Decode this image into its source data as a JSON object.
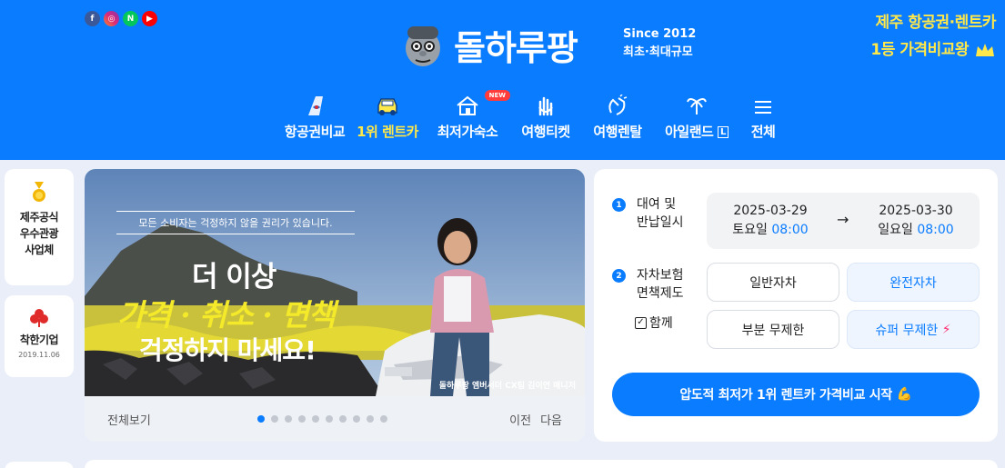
{
  "header": {
    "socials": [
      {
        "name": "facebook-icon",
        "glyph": "f"
      },
      {
        "name": "instagram-icon",
        "glyph": "◎"
      },
      {
        "name": "naver-icon",
        "glyph": "N"
      },
      {
        "name": "youtube-icon",
        "glyph": "▶"
      }
    ],
    "logo_text": "돌하루팡",
    "since_line1": "Since 2012",
    "since_line2": "최초·최대규모",
    "promo_line1": "제주 항공권·렌트카",
    "promo_line2": "1등 가격비교왕",
    "nav": [
      {
        "label": "항공권비교",
        "icon": "airplane-tail-icon",
        "active": false
      },
      {
        "label": "1위 렌트카",
        "icon": "car-icon",
        "active": true
      },
      {
        "label": "최저가숙소",
        "icon": "house-icon",
        "active": false,
        "badge": "NEW"
      },
      {
        "label": "여행티켓",
        "icon": "hand-rock-icon",
        "active": false
      },
      {
        "label": "여행렌탈",
        "icon": "clap-icon",
        "active": false
      },
      {
        "label": "아일랜드",
        "icon": "palm-tree-icon",
        "active": false,
        "suffix": "L"
      },
      {
        "label": "전체",
        "icon": "menu-icon",
        "active": false
      }
    ]
  },
  "side": {
    "card1_lines": [
      "제주공식",
      "우수관광",
      "사업체"
    ],
    "card2_title": "착한기업",
    "card2_date": "2019.11.06"
  },
  "banner": {
    "caption": "모든 소비자는 걱정하지 않을 권리가 있습니다.",
    "line1": "더 이상",
    "line2": "가격 · 취소 · 면책",
    "line3": "걱정하지 마세요!",
    "credit": "돌하루팡 엠버서더 CX팀 김이연 매니저",
    "view_all": "전체보기",
    "prev": "이전",
    "next": "다음",
    "dot_count": 10,
    "active_dot": 0
  },
  "booking": {
    "step1_num": "1",
    "step1_label_1": "대여 및",
    "step1_label_2": "반납일시",
    "pickup_date": "2025-03-29",
    "pickup_day": "토요일",
    "pickup_time": "08:00",
    "return_date": "2025-03-30",
    "return_day": "일요일",
    "return_time": "08:00",
    "step2_num": "2",
    "step2_label_1": "자차보험",
    "step2_label_2": "면책제도",
    "with_label": "함께",
    "options": [
      "일반자차",
      "완전자차",
      "부분 무제한",
      "슈퍼 무제한"
    ],
    "cta": "압도적 최저가 1위 렌트카 가격비교 시작"
  },
  "colors": {
    "brand_blue": "#0a7cff",
    "promo_yellow": "#ffe84a"
  }
}
